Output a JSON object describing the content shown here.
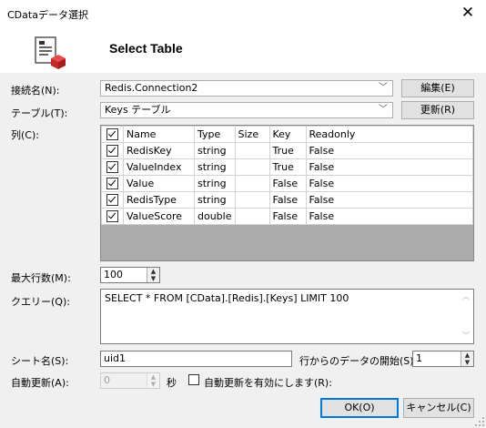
{
  "window": {
    "title": "CDataデータ選択",
    "close_glyph": "✕",
    "header_title": "Select Table"
  },
  "connection": {
    "label": "接続名(N):",
    "value": "Redis.Connection2",
    "edit_button": "編集(E)"
  },
  "table": {
    "label": "テーブル(T):",
    "value": "Keys テーブル",
    "refresh_button": "更新(R)"
  },
  "columns": {
    "label": "列(C):",
    "headers": [
      "Name",
      "Type",
      "Size",
      "Key",
      "Readonly"
    ],
    "rows": [
      {
        "name": "RedisKey",
        "type": "string",
        "size": "",
        "key": "True",
        "readonly": "False"
      },
      {
        "name": "ValueIndex",
        "type": "string",
        "size": "",
        "key": "True",
        "readonly": "False"
      },
      {
        "name": "Value",
        "type": "string",
        "size": "",
        "key": "False",
        "readonly": "False"
      },
      {
        "name": "RedisType",
        "type": "string",
        "size": "",
        "key": "False",
        "readonly": "False"
      },
      {
        "name": "ValueScore",
        "type": "double",
        "size": "",
        "key": "False",
        "readonly": "False"
      }
    ]
  },
  "max_rows": {
    "label": "最大行数(M):",
    "value": "100"
  },
  "query": {
    "label": "クエリー(Q):",
    "value": "SELECT * FROM [CData].[Redis].[Keys] LIMIT 100"
  },
  "sheet": {
    "label": "シート名(S):",
    "value": "uid1",
    "start_label": "行からのデータの開始(S):",
    "start_value": "1"
  },
  "auto_refresh": {
    "label": "自動更新(A):",
    "value": "0",
    "unit": "秒",
    "enable_label": "自動更新を有効にします(R):"
  },
  "buttons": {
    "ok": "OK(O)",
    "cancel": "キャンセル(C)"
  }
}
